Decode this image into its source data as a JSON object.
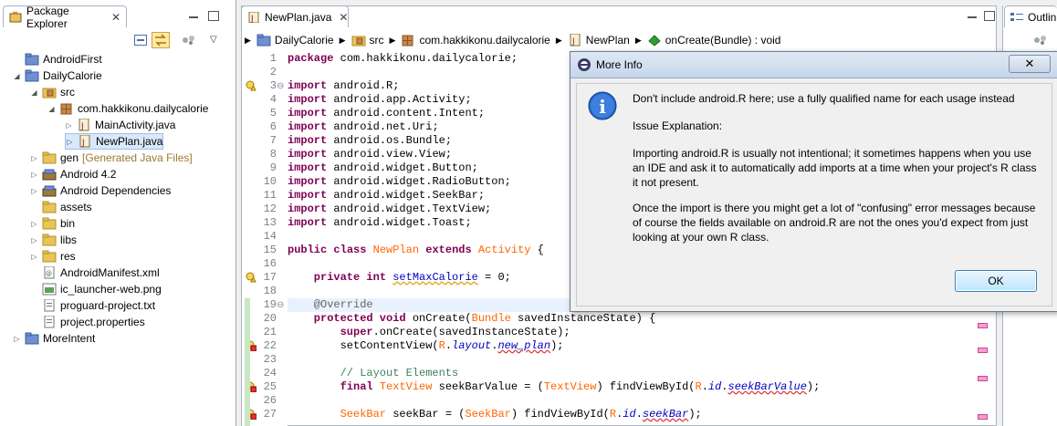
{
  "package_explorer": {
    "tab_label": "Package Explorer",
    "close": "✕",
    "tree": [
      {
        "label": "AndroidFirst",
        "depth": 0,
        "twisty": "",
        "icon": "project-icon"
      },
      {
        "label": "DailyCalorie",
        "depth": 0,
        "twisty": "◢",
        "icon": "project-icon"
      },
      {
        "label": "src",
        "depth": 1,
        "twisty": "◢",
        "icon": "source-folder-icon"
      },
      {
        "label": "com.hakkikonu.dailycalorie",
        "depth": 2,
        "twisty": "◢",
        "icon": "package-icon"
      },
      {
        "label": "MainActivity.java",
        "depth": 3,
        "twisty": "▷",
        "icon": "java-file-icon"
      },
      {
        "label": "NewPlan.java",
        "depth": 3,
        "twisty": "▷",
        "icon": "java-file-icon"
      },
      {
        "label": "gen",
        "label_extra": "[Generated Java Files]",
        "depth": 1,
        "twisty": "▷",
        "icon": "folder-icon"
      },
      {
        "label": "Android 4.2",
        "depth": 1,
        "twisty": "▷",
        "icon": "library-icon"
      },
      {
        "label": "Android Dependencies",
        "depth": 1,
        "twisty": "▷",
        "icon": "library-icon"
      },
      {
        "label": "assets",
        "depth": 1,
        "twisty": "",
        "icon": "folder-icon"
      },
      {
        "label": "bin",
        "depth": 1,
        "twisty": "▷",
        "icon": "folder-icon"
      },
      {
        "label": "libs",
        "depth": 1,
        "twisty": "▷",
        "icon": "folder-icon"
      },
      {
        "label": "res",
        "depth": 1,
        "twisty": "▷",
        "icon": "folder-icon"
      },
      {
        "label": "AndroidManifest.xml",
        "depth": 1,
        "twisty": "",
        "icon": "xml-file-icon"
      },
      {
        "label": "ic_launcher-web.png",
        "depth": 1,
        "twisty": "",
        "icon": "image-file-icon"
      },
      {
        "label": "proguard-project.txt",
        "depth": 1,
        "twisty": "",
        "icon": "text-file-icon"
      },
      {
        "label": "project.properties",
        "depth": 1,
        "twisty": "",
        "icon": "text-file-icon"
      },
      {
        "label": "MoreIntent",
        "depth": 0,
        "twisty": "▷",
        "icon": "project-icon"
      }
    ]
  },
  "editor": {
    "tab_label": "NewPlan.java",
    "close": "✕",
    "breadcrumb": [
      "DailyCalorie",
      "src",
      "com.hakkikonu.dailycalorie",
      "NewPlan",
      "onCreate(Bundle) : void"
    ],
    "lines": [
      {
        "n": "1",
        "fold": "",
        "marker": ""
      },
      {
        "n": "2",
        "fold": "",
        "marker": ""
      },
      {
        "n": "3",
        "fold": "⊖",
        "marker": "warning"
      },
      {
        "n": "4",
        "fold": "",
        "marker": ""
      },
      {
        "n": "5",
        "fold": "",
        "marker": ""
      },
      {
        "n": "6",
        "fold": "",
        "marker": ""
      },
      {
        "n": "7",
        "fold": "",
        "marker": ""
      },
      {
        "n": "8",
        "fold": "",
        "marker": ""
      },
      {
        "n": "9",
        "fold": "",
        "marker": ""
      },
      {
        "n": "10",
        "fold": "",
        "marker": ""
      },
      {
        "n": "11",
        "fold": "",
        "marker": ""
      },
      {
        "n": "12",
        "fold": "",
        "marker": ""
      },
      {
        "n": "13",
        "fold": "",
        "marker": ""
      },
      {
        "n": "14",
        "fold": "",
        "marker": ""
      },
      {
        "n": "15",
        "fold": "",
        "marker": ""
      },
      {
        "n": "16",
        "fold": "",
        "marker": ""
      },
      {
        "n": "17",
        "fold": "",
        "marker": "warning"
      },
      {
        "n": "18",
        "fold": "",
        "marker": ""
      },
      {
        "n": "19",
        "fold": "⊖",
        "marker": ""
      },
      {
        "n": "20",
        "fold": "",
        "marker": ""
      },
      {
        "n": "21",
        "fold": "",
        "marker": ""
      },
      {
        "n": "22",
        "fold": "",
        "marker": "error"
      },
      {
        "n": "23",
        "fold": "",
        "marker": ""
      },
      {
        "n": "24",
        "fold": "",
        "marker": ""
      },
      {
        "n": "25",
        "fold": "",
        "marker": "error"
      },
      {
        "n": "26",
        "fold": "",
        "marker": ""
      },
      {
        "n": "27",
        "fold": "",
        "marker": "error"
      }
    ],
    "code": {
      "l1_kw": "package",
      "l1_rest": " com.hakkikonu.dailycalorie;",
      "import_kw": "import",
      "imports": [
        " android.R;",
        " android.app.Activity;",
        " android.content.Intent;",
        " android.net.Uri;",
        " android.os.Bundle;",
        " android.view.View;",
        " android.widget.Button;",
        " android.widget.RadioButton;",
        " android.widget.SeekBar;",
        " android.widget.TextView;",
        " android.widget.Toast;"
      ],
      "l15_public": "public",
      "l15_class": " class ",
      "l15_name": "NewPlan",
      "l15_extends": " extends ",
      "l15_super": "Activity",
      "l15_end": " {",
      "l17_private": "private",
      "l17_int": " int ",
      "l17_field": "setMaxCalorie",
      "l17_end": " = 0;",
      "l19_ann": "@Override",
      "l20_protected": "protected",
      "l20_void": " void",
      "l20_mid": " onCreate(",
      "l20_bundle": "Bundle",
      "l20_end": " savedInstanceState) {",
      "l21_super": "super",
      "l21_end": ".onCreate(savedInstanceState);",
      "l22_start": "setContentView(",
      "l22_r": "R",
      "l22_dot1": ".",
      "l22_layout": "layout",
      "l22_dot2": ".",
      "l22_plan": "new_plan",
      "l22_end": ");",
      "l24_comment": "// Layout Elements",
      "l25_final": "final",
      "l25_sp": " ",
      "l25_tv": "TextView",
      "l25_mid": " seekBarValue = (",
      "l25_tv2": "TextView",
      "l25_mid2": ") findViewById(",
      "l25_r": "R",
      "l25_dot1": ".",
      "l25_id": "id",
      "l25_dot2": ".",
      "l25_name": "seekBarValue",
      "l25_end": ");",
      "l27_sb": "SeekBar",
      "l27_mid": " seekBar = (",
      "l27_sb2": "SeekBar",
      "l27_mid2": ") findViewById(",
      "l27_r": "R",
      "l27_dot1": ".",
      "l27_id": "id",
      "l27_dot2": ".",
      "l27_name": "seekBar",
      "l27_end": ");"
    }
  },
  "outline": {
    "tab_label": "Outlin"
  },
  "dialog": {
    "title": "More Info",
    "close": "✕",
    "message": "Don't include android.R here; use a fully qualified name for each usage instead",
    "heading": "Issue Explanation:",
    "para1": "Importing android.R is usually not intentional; it sometimes happens when you use an IDE and ask it to automatically add imports at a time when your project's R class it not present.",
    "para2": "Once the import is there you might get a lot of \"confusing\" error messages because of course the fields available on android.R are not the ones you'd expect from just looking at your own R class.",
    "ok_label": "OK",
    "icon_glyph": "i"
  },
  "colors": {
    "keyword": "#7f0055",
    "type_highlight": "#ff6600",
    "comment": "#3f7f5f",
    "field": "#0000c0"
  }
}
